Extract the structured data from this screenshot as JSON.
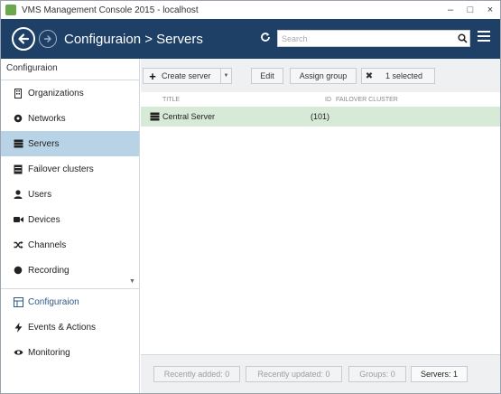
{
  "window": {
    "title": "VMS Management Console 2015 - localhost",
    "controls": {
      "minimize": "–",
      "maximize": "□",
      "close": "×"
    }
  },
  "header": {
    "title": "Configuraion > Servers",
    "search_placeholder": "Search",
    "colors": {
      "background": "#1e3f66",
      "text": "#ffffff"
    }
  },
  "sidebar": {
    "heading": "Configuraion",
    "items": [
      {
        "label": "Organizations",
        "icon": "organizations-icon",
        "active": false
      },
      {
        "label": "Networks",
        "icon": "networks-icon",
        "active": false
      },
      {
        "label": "Servers",
        "icon": "servers-icon",
        "active": true
      },
      {
        "label": "Failover clusters",
        "icon": "failover-clusters-icon",
        "active": false
      },
      {
        "label": "Users",
        "icon": "user-icon",
        "active": false
      },
      {
        "label": "Devices",
        "icon": "camera-icon",
        "active": false
      },
      {
        "label": "Channels",
        "icon": "shuffle-icon",
        "active": false
      },
      {
        "label": "Recording",
        "icon": "record-icon",
        "active": false
      }
    ],
    "sections": [
      {
        "label": "Configuraion",
        "icon": "configuration-icon",
        "active": true
      },
      {
        "label": "Events & Actions",
        "icon": "lightning-icon",
        "active": false
      },
      {
        "label": "Monitoring",
        "icon": "eye-icon",
        "active": false
      }
    ],
    "active_color": "#b9d3e6"
  },
  "toolbar": {
    "create_label": "Create server",
    "edit_label": "Edit",
    "assign_label": "Assign group",
    "selected_label": "1 selected"
  },
  "table": {
    "columns": {
      "title": "TITLE",
      "id": "ID",
      "failover": "FAILOVER CLUSTER"
    },
    "rows": [
      {
        "title": "Central Server",
        "id": "(101)",
        "failover": ""
      }
    ],
    "selected_row_color": "#d6ead7"
  },
  "footer": {
    "recent_added": "Recently added: 0",
    "recent_updated": "Recently updated: 0",
    "groups": "Groups: 0",
    "servers": "Servers: 1"
  }
}
